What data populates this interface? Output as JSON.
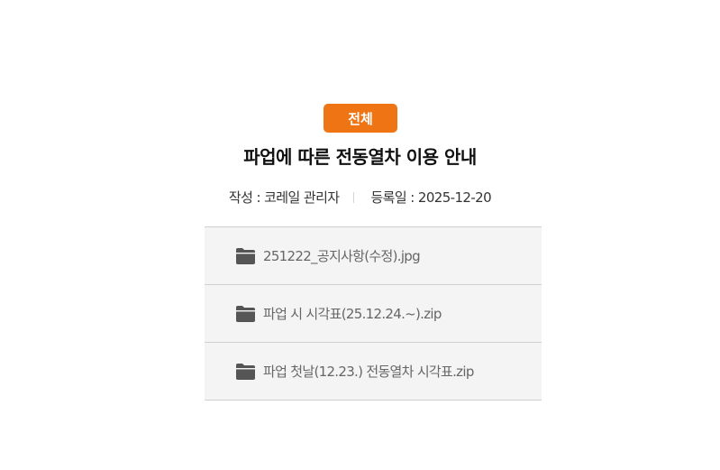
{
  "post": {
    "category": "전체",
    "title": "파업에 따른 전동열차 이용 안내",
    "author": "작성 : 코레일 관리자",
    "date": "등록일 : 2025-12-20"
  },
  "attachments": [
    {
      "name": "251222_공지사항(수정).jpg",
      "icon": "folder-icon"
    },
    {
      "name": "파업 시 시각표(25.12.24.~).zip",
      "icon": "folder-icon"
    },
    {
      "name": "파업 첫날(12.23.) 전동열차 시각표.zip",
      "icon": "folder-icon"
    }
  ],
  "colors": {
    "accent": "#ef7414",
    "attachment_bg": "#f4f4f4",
    "divider": "#cfcfcf"
  }
}
